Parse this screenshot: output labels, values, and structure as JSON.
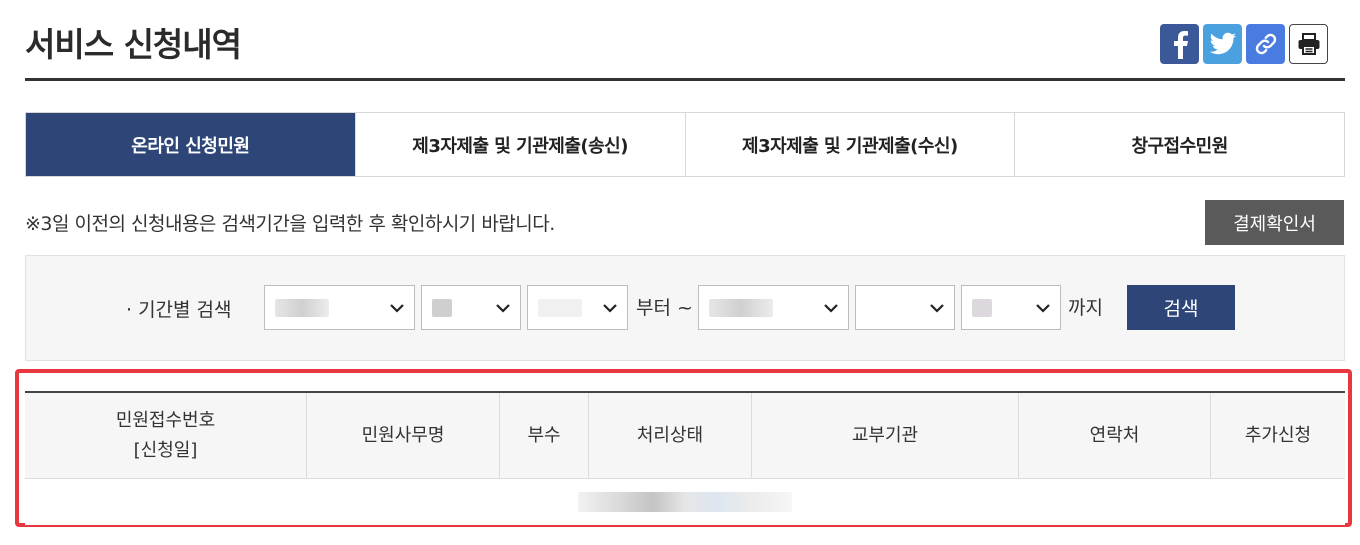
{
  "page": {
    "title": "서비스 신청내역"
  },
  "share": {
    "facebook_icon": "facebook-icon",
    "twitter_icon": "twitter-icon",
    "link_icon": "link-icon",
    "print_icon": "print-icon"
  },
  "tabs": [
    {
      "label": "온라인 신청민원",
      "active": true
    },
    {
      "label": "제3자제출 및 기관제출(송신)",
      "active": false
    },
    {
      "label": "제3자제출 및 기관제출(수신)",
      "active": false
    },
    {
      "label": "창구접수민원",
      "active": false
    }
  ],
  "notice": "※3일 이전의 신청내용은 검색기간을 입력한 후 확인하시기 바랍니다.",
  "confirm_button": "결제확인서",
  "search": {
    "label": "· 기간별 검색",
    "from_word": "부터 ~",
    "to_word": "까지",
    "button": "검색"
  },
  "table": {
    "columns": [
      {
        "line1": "민원접수번호",
        "line2": "[신청일]"
      },
      {
        "line1": "민원사무명"
      },
      {
        "line1": "부수"
      },
      {
        "line1": "처리상태"
      },
      {
        "line1": "교부기관"
      },
      {
        "line1": "연락처"
      },
      {
        "line1": "추가신청"
      }
    ]
  },
  "colors": {
    "accent": "#2d4677",
    "highlight": "#e8383f",
    "confirm_button": "#5a5a5a"
  }
}
